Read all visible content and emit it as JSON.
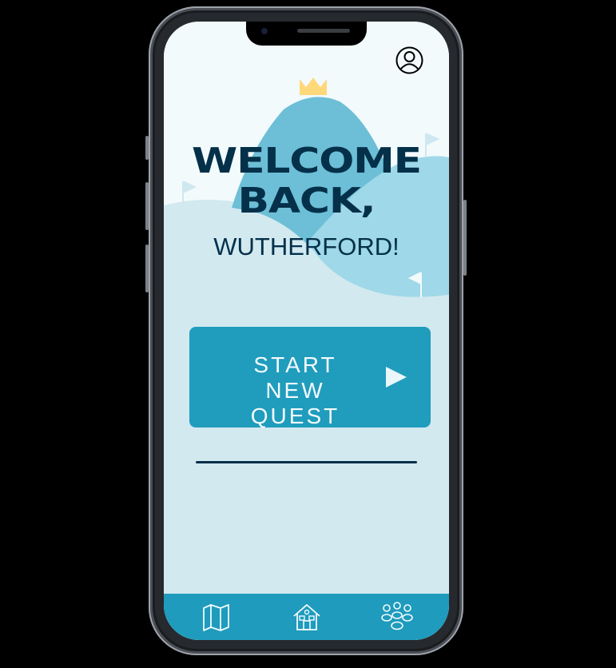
{
  "greeting": {
    "line1": "WELCOME",
    "line2": "BACK,",
    "name": "WUTHERFORD!"
  },
  "primary_action": {
    "label": "START NEW QUEST",
    "icon": "play-icon"
  },
  "header": {
    "profile_icon": "user-circle-icon"
  },
  "bottom_nav": [
    {
      "icon": "map-icon",
      "name": "Map"
    },
    {
      "icon": "home-icon",
      "name": "Home"
    },
    {
      "icon": "group-icon",
      "name": "Group"
    }
  ],
  "colors": {
    "background": "#d2e9f0",
    "accent": "#209cbd",
    "text_dark": "#04304a",
    "crown": "#ffd87a"
  }
}
